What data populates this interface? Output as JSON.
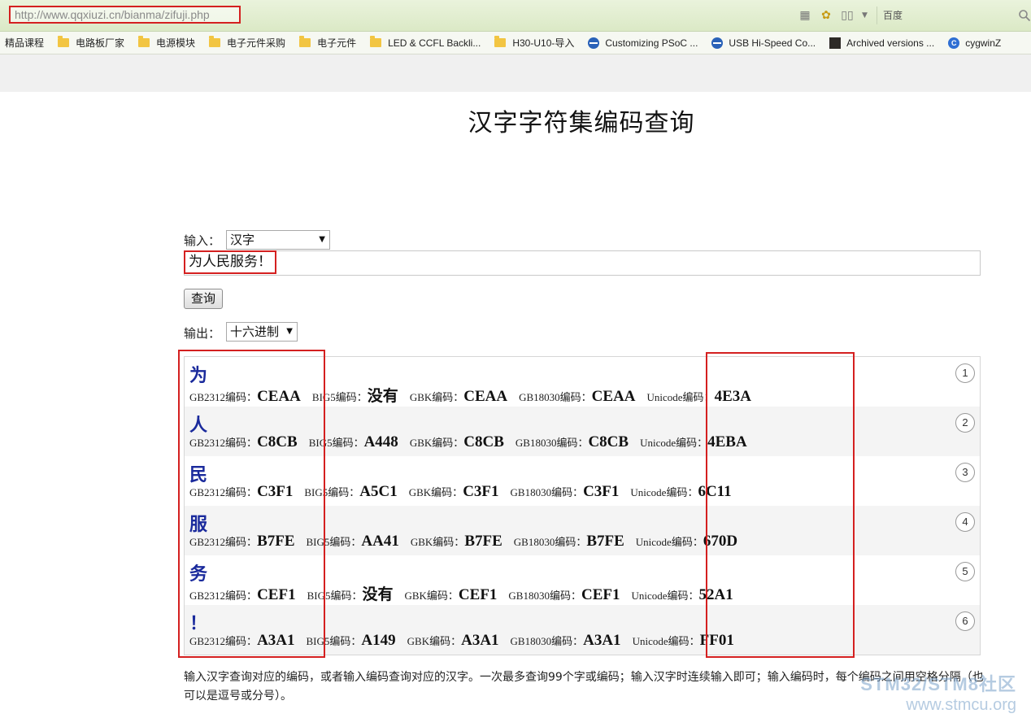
{
  "browser": {
    "url": "http://www.qqxiuzi.cn/bianma/zifuji.php",
    "search_engine": "百度",
    "bookmarks": [
      {
        "label": "精品课程",
        "icon": "none"
      },
      {
        "label": "电路板厂家",
        "icon": "folder-icon"
      },
      {
        "label": "电源模块",
        "icon": "folder-icon"
      },
      {
        "label": "电子元件采购",
        "icon": "folder-icon"
      },
      {
        "label": "电子元件",
        "icon": "folder-icon"
      },
      {
        "label": "LED & CCFL Backli...",
        "icon": "folder-icon"
      },
      {
        "label": "H30-U10-导入",
        "icon": "folder-icon"
      },
      {
        "label": "Customizing PSoC ...",
        "icon": "globe-icon"
      },
      {
        "label": "USB Hi-Speed Co...",
        "icon": "globe-icon"
      },
      {
        "label": "Archived versions ...",
        "icon": "site-icon"
      },
      {
        "label": "cygwinZ",
        "icon": "cygwin-icon"
      }
    ]
  },
  "page": {
    "title": "汉字字符集编码查询",
    "input_label": "输入：",
    "input_type": "汉字",
    "input_value": "为人民服务！",
    "query_button": "查询",
    "output_label": "输出：",
    "output_format": "十六进制",
    "footer_note": "输入汉字查询对应的编码，或者输入编码查询对应的汉字。一次最多查询99个字或编码；输入汉字时连续输入即可；输入编码时，每个编码之间用空格分隔（也可以是逗号或分号）。"
  },
  "results": [
    {
      "index": "1",
      "char": "为",
      "gb2312_label": "GB2312编码：",
      "gb2312": "CEAA",
      "big5_label": "BIG5编码：",
      "big5": "没有",
      "gbk_label": "GBK编码：",
      "gbk": "CEAA",
      "gb18030_label": "GB18030编码：",
      "gb18030": "CEAA",
      "unicode_label": "Unicode编码：",
      "unicode": "4E3A"
    },
    {
      "index": "2",
      "char": "人",
      "gb2312_label": "GB2312编码：",
      "gb2312": "C8CB",
      "big5_label": "BIG5编码：",
      "big5": "A448",
      "gbk_label": "GBK编码：",
      "gbk": "C8CB",
      "gb18030_label": "GB18030编码：",
      "gb18030": "C8CB",
      "unicode_label": "Unicode编码：",
      "unicode": "4EBA"
    },
    {
      "index": "3",
      "char": "民",
      "gb2312_label": "GB2312编码：",
      "gb2312": "C3F1",
      "big5_label": "BIG5编码：",
      "big5": "A5C1",
      "gbk_label": "GBK编码：",
      "gbk": "C3F1",
      "gb18030_label": "GB18030编码：",
      "gb18030": "C3F1",
      "unicode_label": "Unicode编码：",
      "unicode": "6C11"
    },
    {
      "index": "4",
      "char": "服",
      "gb2312_label": "GB2312编码：",
      "gb2312": "B7FE",
      "big5_label": "BIG5编码：",
      "big5": "AA41",
      "gbk_label": "GBK编码：",
      "gbk": "B7FE",
      "gb18030_label": "GB18030编码：",
      "gb18030": "B7FE",
      "unicode_label": "Unicode编码：",
      "unicode": "670D"
    },
    {
      "index": "5",
      "char": "务",
      "gb2312_label": "GB2312编码：",
      "gb2312": "CEF1",
      "big5_label": "BIG5编码：",
      "big5": "没有",
      "gbk_label": "GBK编码：",
      "gbk": "CEF1",
      "gb18030_label": "GB18030编码：",
      "gb18030": "CEF1",
      "unicode_label": "Unicode编码：",
      "unicode": "52A1"
    },
    {
      "index": "6",
      "char": "！",
      "gb2312_label": "GB2312编码：",
      "gb2312": "A3A1",
      "big5_label": "BIG5编码：",
      "big5": "A149",
      "gbk_label": "GBK编码：",
      "gbk": "A3A1",
      "gb18030_label": "GB18030编码：",
      "gb18030": "A3A1",
      "unicode_label": "Unicode编码：",
      "unicode": "FF01"
    }
  ],
  "watermark": {
    "line1": "STM32/STM8社区",
    "line2": "www.stmcu.org"
  },
  "colors": {
    "highlight": "#d42020",
    "char_color": "#1a2a9c"
  }
}
